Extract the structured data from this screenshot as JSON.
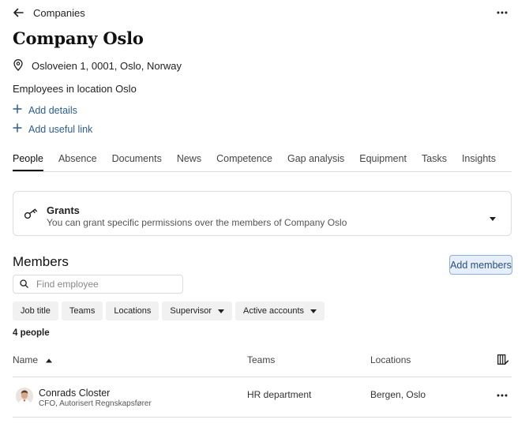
{
  "header": {
    "breadcrumb": "Companies",
    "back_icon": "arrow-left-icon",
    "more_icon": "more-horizontal-icon"
  },
  "company": {
    "title": "Company Oslo",
    "address": "Osloveien 1, 0001, Oslo, Norway",
    "address_icon": "location-pin-icon",
    "employees_note": "Employees in location Oslo"
  },
  "actions": {
    "add_details": "Add details",
    "add_useful_link": "Add useful link"
  },
  "tabs": [
    {
      "label": "People",
      "active": true
    },
    {
      "label": "Absence",
      "active": false
    },
    {
      "label": "Documents",
      "active": false
    },
    {
      "label": "News",
      "active": false
    },
    {
      "label": "Competence",
      "active": false
    },
    {
      "label": "Gap analysis",
      "active": false
    },
    {
      "label": "Equipment",
      "active": false
    },
    {
      "label": "Tasks",
      "active": false
    },
    {
      "label": "Insights",
      "active": false
    }
  ],
  "grants": {
    "title": "Grants",
    "description": "You can grant specific permissions over the members of Company Oslo",
    "icon": "key-icon"
  },
  "members": {
    "title": "Members",
    "add_button": "Add members",
    "search_placeholder": "Find employee",
    "filters": [
      {
        "label": "Job title",
        "dropdown": false
      },
      {
        "label": "Teams",
        "dropdown": false
      },
      {
        "label": "Locations",
        "dropdown": false
      },
      {
        "label": "Supervisor",
        "dropdown": true
      },
      {
        "label": "Active accounts",
        "dropdown": true
      }
    ],
    "count": "4 people",
    "columns": {
      "name": "Name",
      "teams": "Teams",
      "locations": "Locations"
    },
    "rows": [
      {
        "name": "Conrads Closter",
        "title": "CFO, Autorisert Regnskapsfører",
        "team": "HR department",
        "locations": "Bergen, Oslo"
      }
    ]
  },
  "colors": {
    "link": "#2d5d8f",
    "primary_bg": "#e6eef9",
    "primary_border": "#8fb0d9",
    "divider": "#dcdcdc"
  }
}
